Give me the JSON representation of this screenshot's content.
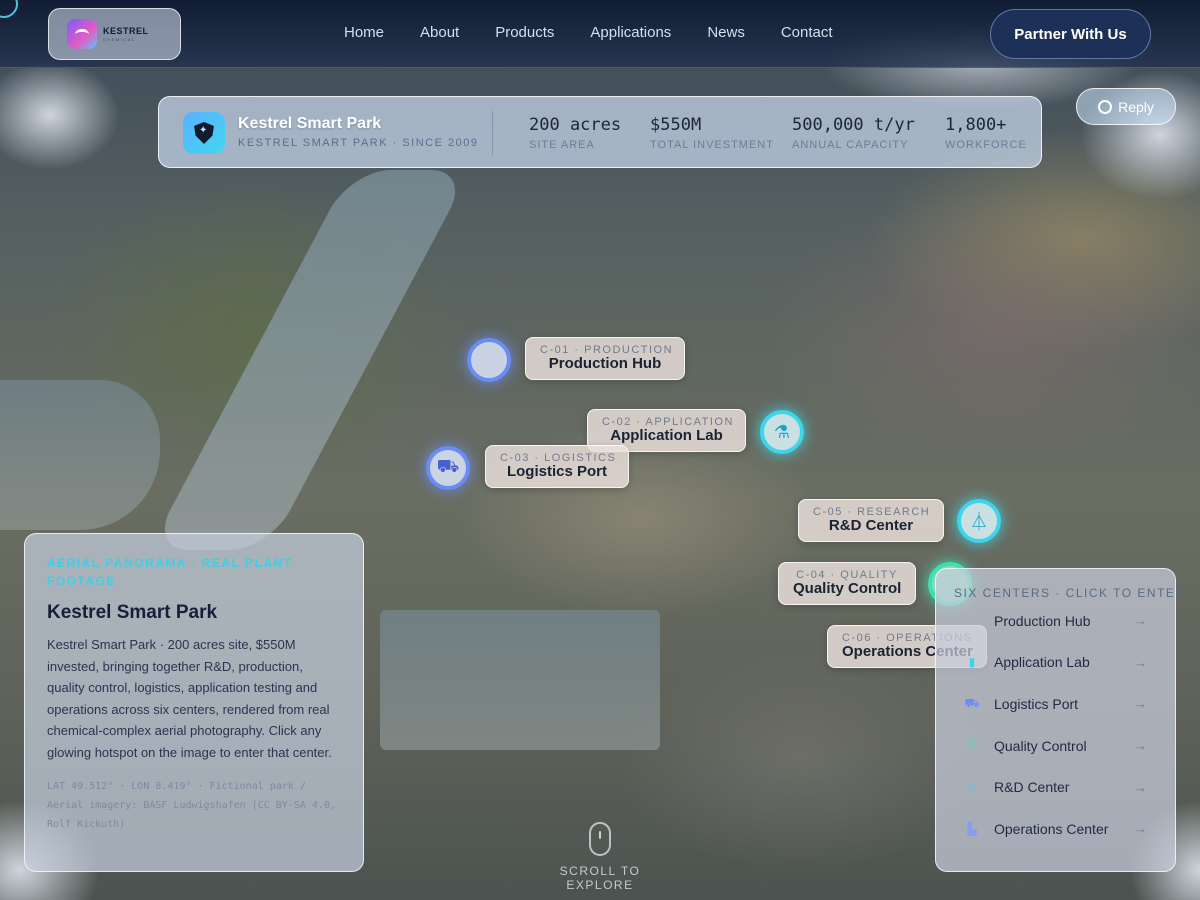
{
  "header": {
    "logo_name": "KESTREL",
    "logo_sub": "CHEMICAL",
    "nav": [
      "Home",
      "About",
      "Products",
      "Applications",
      "News",
      "Contact"
    ],
    "cta": "Partner With Us"
  },
  "stats_bar": {
    "title": "Kestrel Smart Park",
    "subtitle": "KESTREL SMART PARK · SINCE 2009",
    "stats": [
      {
        "value": "200 acres",
        "label": "SITE AREA"
      },
      {
        "value": "$550M",
        "label": "TOTAL INVESTMENT"
      },
      {
        "value": "500,000 t/yr",
        "label": "ANNUAL CAPACITY"
      },
      {
        "value": "1,800+",
        "label": "WORKFORCE"
      }
    ]
  },
  "reply_label": "Reply",
  "hotspots": [
    {
      "code": "C-01 · PRODUCTION",
      "name": "Production Hub"
    },
    {
      "code": "C-02 · APPLICATION",
      "name": "Application Lab"
    },
    {
      "code": "C-03 · LOGISTICS",
      "name": "Logistics Port"
    },
    {
      "code": "C-04 · QUALITY",
      "name": "Quality Control"
    },
    {
      "code": "C-05 · RESEARCH",
      "name": "R&D Center"
    },
    {
      "code": "C-06 · OPERATIONS",
      "name": "Operations Center"
    }
  ],
  "intro": {
    "kicker": "AERIAL PANORAMA · REAL PLANT FOOTAGE",
    "title": "Kestrel Smart Park",
    "body": "Kestrel Smart Park · 200 acres site, $550M invested, bringing together R&D, production, quality control, logistics, application testing and operations across six centers, rendered from real chemical-complex aerial photography. Click any glowing hotspot on the image to enter that center.",
    "meta": "LAT 49.512° · LON 8.419° · Fictional park / Aerial imagery: BASF Ludwigshafen (CC BY-SA 4.0, Rolf Kickuth)"
  },
  "centers_panel": {
    "header": "SIX CENTERS · CLICK TO ENTER",
    "items": [
      {
        "label": "Production Hub",
        "icon": "factory-icon",
        "color": "#6b8cf0"
      },
      {
        "label": "Application Lab",
        "icon": "test-tube-icon",
        "color": "#3dd6e8"
      },
      {
        "label": "Logistics Port",
        "icon": "truck-icon",
        "color": "#6b8cf0"
      },
      {
        "label": "Quality Control",
        "icon": "shield-check-icon",
        "color": "#3de0b0"
      },
      {
        "label": "R&D Center",
        "icon": "flask-icon",
        "color": "#3dd6e8"
      },
      {
        "label": "Operations Center",
        "icon": "chart-bars-icon",
        "color": "#8a9cf0"
      }
    ],
    "arrow": "→"
  },
  "scroll_cue": "SCROLL TO EXPLORE"
}
